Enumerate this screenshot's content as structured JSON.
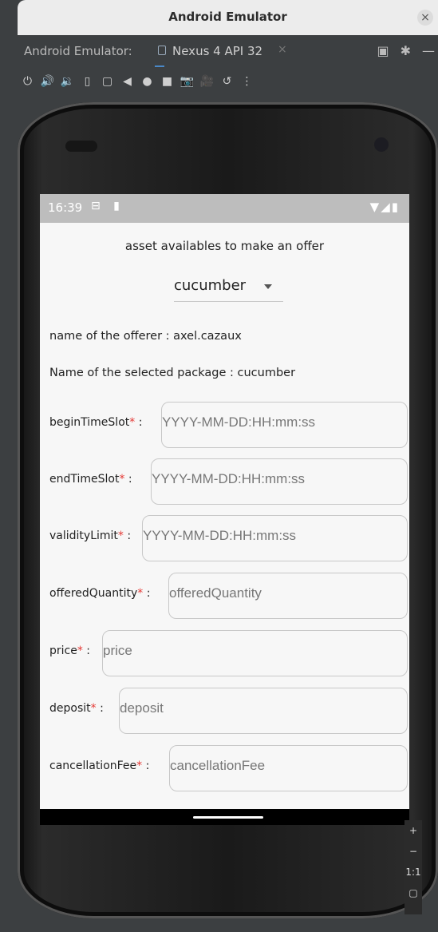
{
  "window": {
    "title": "Android Emulator",
    "close": "×"
  },
  "tabbar": {
    "label": "Android Emulator:",
    "tab": "Nexus 4 API 32",
    "tab_close": "×"
  },
  "toolbar_icons": [
    "⏻",
    "🔊",
    "🔉",
    "▯",
    "▢",
    "◀",
    "●",
    "■",
    "📷",
    "🎥",
    "↺",
    "⋮"
  ],
  "statusbar": {
    "time": "16:39",
    "icons": "⊟ ▮",
    "right": "▼◢▮"
  },
  "app": {
    "heading": "asset availables to make an offer",
    "dropdown_value": "cucumber",
    "offerer": "name of the offerer : axel.cazaux",
    "package": "Name of the selected package : cucumber",
    "fields": [
      {
        "label": "beginTimeSlot",
        "placeholder": "YYYY-MM-DD:HH:mm:ss"
      },
      {
        "label": "endTimeSlot",
        "placeholder": "YYYY-MM-DD:HH:mm:ss"
      },
      {
        "label": "validityLimit",
        "placeholder": "YYYY-MM-DD:HH:mm:ss"
      },
      {
        "label": "offeredQuantity",
        "placeholder": "offeredQuantity"
      },
      {
        "label": "price",
        "placeholder": "price"
      },
      {
        "label": "deposit",
        "placeholder": "deposit"
      },
      {
        "label": "cancellationFee",
        "placeholder": "cancellationFee"
      }
    ],
    "required_mark": "*",
    "colon": " :"
  },
  "zoom": {
    "plus": "+",
    "minus": "−",
    "ratio": "1:1"
  }
}
